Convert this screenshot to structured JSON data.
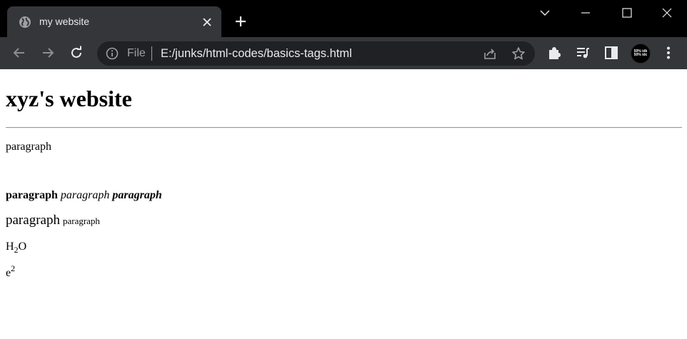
{
  "browser": {
    "tab_title": "my website",
    "scheme_label": "File",
    "url": "E:/junks/html-codes/basics-tags.html",
    "avatar_text_line1": "50% idk",
    "avatar_text_line2": "50% idc",
    "colors": {
      "tabstrip": "#000000",
      "toolbar": "#35363a",
      "omnibox": "#202124",
      "icon": "#e8eaed"
    },
    "icons": [
      "globe-icon",
      "close-icon",
      "plus-icon",
      "chevron-down-icon",
      "minimize-icon",
      "maximize-icon",
      "window-close-icon",
      "arrow-left-icon",
      "arrow-right-icon",
      "reload-icon",
      "info-icon",
      "share-icon",
      "star-icon",
      "puzzle-icon",
      "media-queue-icon",
      "side-panel-icon",
      "kebab-menu-icon"
    ]
  },
  "page": {
    "heading": "xyz's website",
    "p1": "paragraph",
    "p2_bold": "paragraph",
    "p2_italic": "paragraph",
    "p2_bold_italic": "paragraph",
    "p3_big": "paragraph",
    "p3_small": "paragraph",
    "h2o_h": "H",
    "h2o_sub": "2",
    "h2o_o": "O",
    "exp_base": "e",
    "exp_sup": "2"
  }
}
